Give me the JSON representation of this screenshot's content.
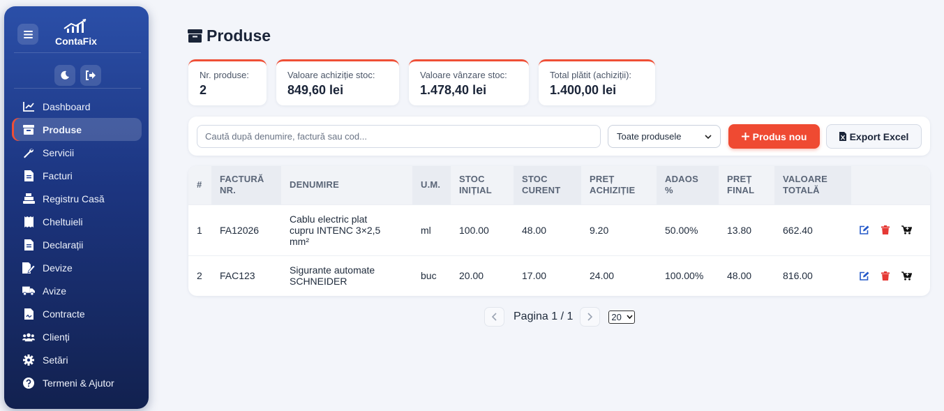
{
  "brand": {
    "name": "ContaFix"
  },
  "sidebar": {
    "items": [
      {
        "label": "Dashboard",
        "icon": "chart-line-icon"
      },
      {
        "label": "Produse",
        "icon": "box-icon",
        "active": true
      },
      {
        "label": "Servicii",
        "icon": "wrench-icon"
      },
      {
        "label": "Facturi",
        "icon": "invoice-icon"
      },
      {
        "label": "Registru Casă",
        "icon": "cash-register-icon"
      },
      {
        "label": "Cheltuieli",
        "icon": "receipt-icon"
      },
      {
        "label": "Declarații",
        "icon": "document-icon"
      },
      {
        "label": "Devize",
        "icon": "file-signature-icon"
      },
      {
        "label": "Avize",
        "icon": "truck-icon"
      },
      {
        "label": "Contracte",
        "icon": "contract-icon"
      },
      {
        "label": "Clienți",
        "icon": "users-icon"
      },
      {
        "label": "Setări",
        "icon": "gear-icon"
      },
      {
        "label": "Termeni & Ajutor",
        "icon": "question-icon"
      }
    ]
  },
  "page": {
    "title": "Produse"
  },
  "stats": [
    {
      "label": "Nr. produse:",
      "value": "2"
    },
    {
      "label": "Valoare achiziție stoc:",
      "value": "849,60 lei"
    },
    {
      "label": "Valoare vânzare stoc:",
      "value": "1.478,40 lei"
    },
    {
      "label": "Total plătit (achiziții):",
      "value": "1.400,00 lei"
    }
  ],
  "toolbar": {
    "search_placeholder": "Caută după denumire, factură sau cod...",
    "filter_value": "Toate produsele",
    "new_label": "Produs nou",
    "export_label": "Export Excel"
  },
  "table": {
    "headers": [
      "#",
      "FACTURĂ NR.",
      "DENUMIRE",
      "U.M.",
      "STOC INIȚIAL",
      "STOC CURENT",
      "PREȚ ACHIZIȚIE",
      "ADAOS %",
      "PREȚ FINAL",
      "VALOARE TOTALĂ"
    ],
    "rows": [
      {
        "nr": "1",
        "factura": "FA12026",
        "denumire": "Cablu electric plat cupru INTENC 3×2,5 mm²",
        "um": "ml",
        "stoc_initial": "100.00",
        "stoc_curent": "48.00",
        "pret_achizitie": "9.20",
        "adaos": "50.00%",
        "pret_final": "13.80",
        "valoare": "662.40"
      },
      {
        "nr": "2",
        "factura": "FAC123",
        "denumire": "Sigurante automate SCHNEIDER",
        "um": "buc",
        "stoc_initial": "20.00",
        "stoc_curent": "17.00",
        "pret_achizitie": "24.00",
        "adaos": "100.00%",
        "pret_final": "48.00",
        "valoare": "816.00"
      }
    ]
  },
  "pagination": {
    "label": "Pagina 1 / 1",
    "page_size": "20"
  },
  "colors": {
    "accent": "#ef4a32",
    "sidebar": "#1c3580",
    "edit": "#2459c9",
    "delete": "#e53935"
  }
}
